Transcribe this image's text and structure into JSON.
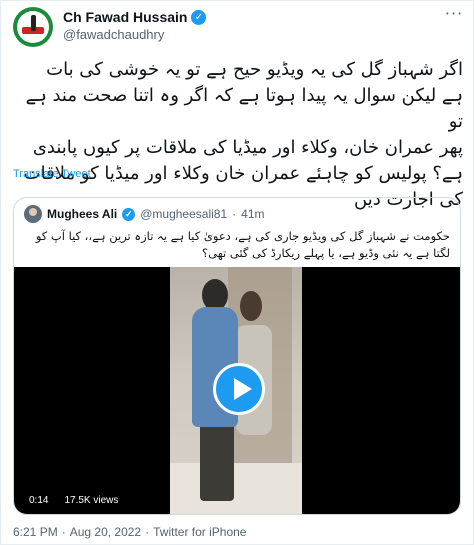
{
  "author": {
    "display_name": "Ch Fawad Hussain",
    "handle": "@fawadchaudhry",
    "verified_icon": "verified-badge-icon"
  },
  "more_icon": "more-options-icon",
  "tweet": {
    "text": "اگر شہباز گل کی یہ ویڈیو حیح ہے تو یہ خوشی کی بات\nہے لیکن سوال یہ پیدا ہوتا ہے کہ اگر وہ اتنا صحت مند ہے تو\nپھر عمران خان، وکلاء اور میڈیا کی ملاقات پر کیوں پابندی\nہے؟ پولیس کو چاہئے عمران خان وکلاء اور میڈیا  کو ملاقات\nکی اجازت دیں",
    "translate_label": "Translate Tweet"
  },
  "quoted": {
    "display_name": "Mughees Ali",
    "handle": "@mugheesali81",
    "separator": "·",
    "time": "41m",
    "text": "حکومت نے شہباز گل کی ویڈیو جاری کی ہے، دعویٰ کیا ہے یہ تازہ ترین ہے،، کیا آپ کو\nلگتا ہے یہ نئی وڈیو ہے، یا پہلے ریکارڈ کی گئی تھی؟",
    "video": {
      "duration": "0:14",
      "views": "17.5K views",
      "play_icon": "play-icon"
    }
  },
  "footer": {
    "time": "6:21 PM",
    "separator1": "·",
    "date": "Aug 20, 2022",
    "separator2": "·",
    "source": "Twitter for iPhone"
  },
  "colors": {
    "accent": "#1d9bf0",
    "text": "#0f1419",
    "muted": "#536471",
    "border": "#cfd9de"
  }
}
